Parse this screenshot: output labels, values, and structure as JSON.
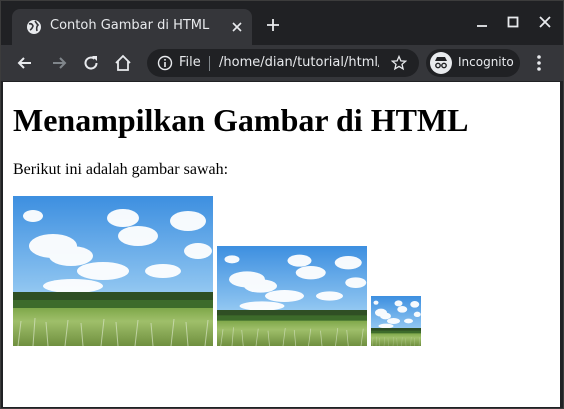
{
  "tab": {
    "title": "Contoh Gambar di HTML",
    "favicon": "globe-icon"
  },
  "toolbar": {
    "scheme_label": "File",
    "url": "/home/dian/tutorial/html/gambar.html",
    "incognito_label": "Incognito"
  },
  "page": {
    "heading": "Menampilkan Gambar di HTML",
    "paragraph": "Berikut ini adalah gambar sawah:"
  },
  "images": [
    {
      "name": "rice-field-image-large",
      "subject": "sawah"
    },
    {
      "name": "rice-field-image-medium",
      "subject": "sawah"
    },
    {
      "name": "rice-field-image-small",
      "subject": "sawah"
    }
  ],
  "colors": {
    "titlebar": "#202124",
    "toolbar": "#35363a",
    "omnibox": "#202124",
    "text": "#e8eaed",
    "page_background": "#ffffff"
  }
}
